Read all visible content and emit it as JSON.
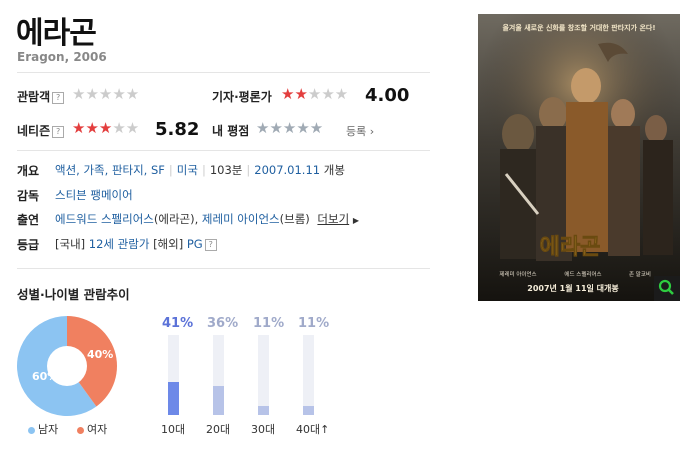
{
  "movie": {
    "title": "에라곤",
    "subtitle": "Eragon, 2006"
  },
  "ratings": {
    "audience_label": "관람객",
    "audience_score": "",
    "critic_label": "기자·평론가",
    "critic_score": "4.00",
    "critic_stars": 2,
    "netizen_label": "네티즌",
    "netizen_score": "5.82",
    "netizen_stars": 3,
    "my_rating_label": "내 평점",
    "register_label": "등록",
    "help_glyph": "?"
  },
  "info": {
    "overview_label": "개요",
    "genres": "액션, 가족, 판타지, SF",
    "country": "미국",
    "runtime": "103분",
    "release_date": "2007.01.11",
    "release_suffix": "개봉",
    "director_label": "감독",
    "director": "스티븐 팽메이어",
    "cast_label": "출연",
    "cast_1": "에드워드 스펠리어스",
    "cast_1_role": "(에라곤)",
    "cast_2": "제레미 아이언스",
    "cast_2_role": "(브롬)",
    "more_label": "더보기",
    "rating_label": "등급",
    "rating_domestic_tag": "[국내]",
    "rating_domestic": "12세 관람가",
    "rating_overseas_tag": "[해외]",
    "rating_overseas": "PG"
  },
  "trend": {
    "title": "성별·나이별 관람추이",
    "male_label": "남자",
    "female_label": "여자",
    "male_pct_text": "60%",
    "female_pct_text": "40%",
    "ages": [
      {
        "label": "10대",
        "pct_text": "41%"
      },
      {
        "label": "20대",
        "pct_text": "36%"
      },
      {
        "label": "30대",
        "pct_text": "11%"
      },
      {
        "label": "40대↑",
        "pct_text": "11%"
      }
    ]
  },
  "chart_data": [
    {
      "type": "pie",
      "categories": [
        "남자",
        "여자"
      ],
      "values": [
        60,
        40
      ],
      "colors": [
        "#8cc4f2",
        "#f08060"
      ]
    },
    {
      "type": "bar",
      "categories": [
        "10대",
        "20대",
        "30대",
        "40대↑"
      ],
      "values": [
        41,
        36,
        11,
        11
      ],
      "ylim": [
        0,
        100
      ],
      "colors": [
        "#6d89e8",
        "#b7c3e8",
        "#b7c3e8",
        "#b7c3e8"
      ]
    }
  ],
  "poster": {
    "tagline": "올겨울 새로운 신화를 창조할 거대한 판타지가 온다!",
    "logo_text": "에라곤",
    "credit_1": "제레미 아이언스",
    "credit_2": "에드 스펠리어스",
    "credit_3": "존 말코비",
    "release_line": "2007년 1월 11일 대개봉",
    "zoom_icon": "magnifier-icon",
    "colors": {
      "bg": "#2a2620",
      "gold": "#e0b040"
    }
  },
  "colors": {
    "star_red": "#e33e3e",
    "star_gray": "#cccccc",
    "link": "#1f5fa0"
  }
}
